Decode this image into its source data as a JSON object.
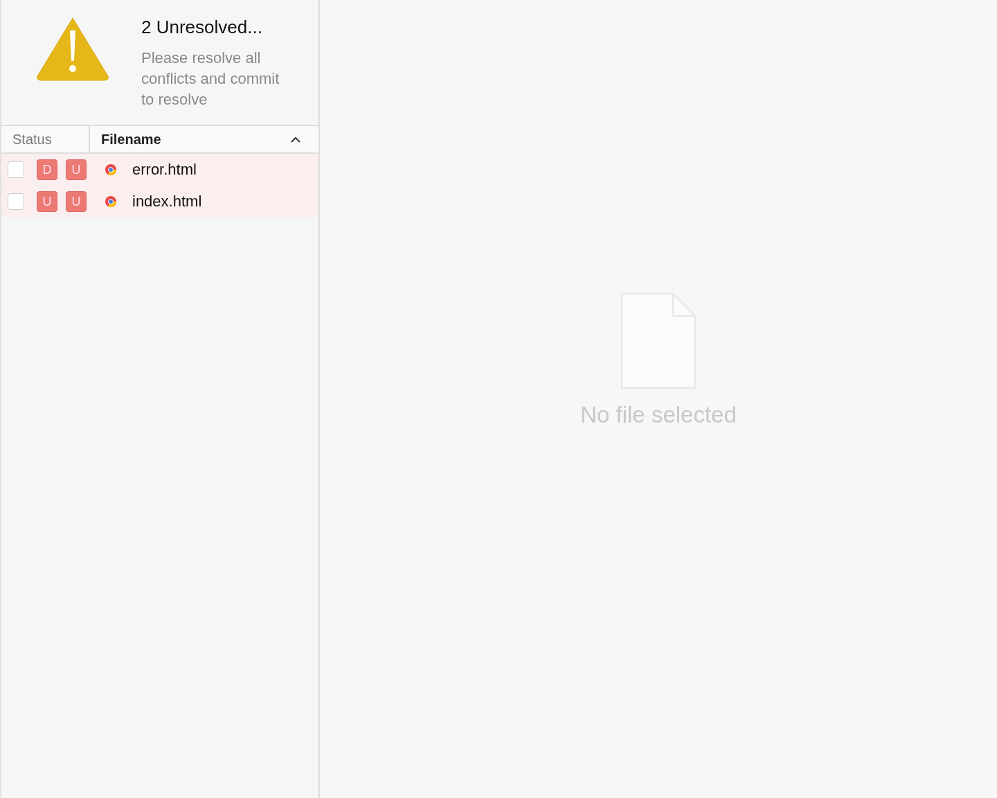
{
  "alert": {
    "title": "2 Unresolved...",
    "message": "Please resolve all conflicts and commit to resolve"
  },
  "table": {
    "columns": [
      "Status",
      "Filename"
    ],
    "rows": [
      {
        "checked": false,
        "badges": [
          "D",
          "U"
        ],
        "filename": "error.html"
      },
      {
        "checked": false,
        "badges": [
          "U",
          "U"
        ],
        "filename": "index.html"
      }
    ]
  },
  "preview": {
    "empty_text": "No file selected"
  }
}
